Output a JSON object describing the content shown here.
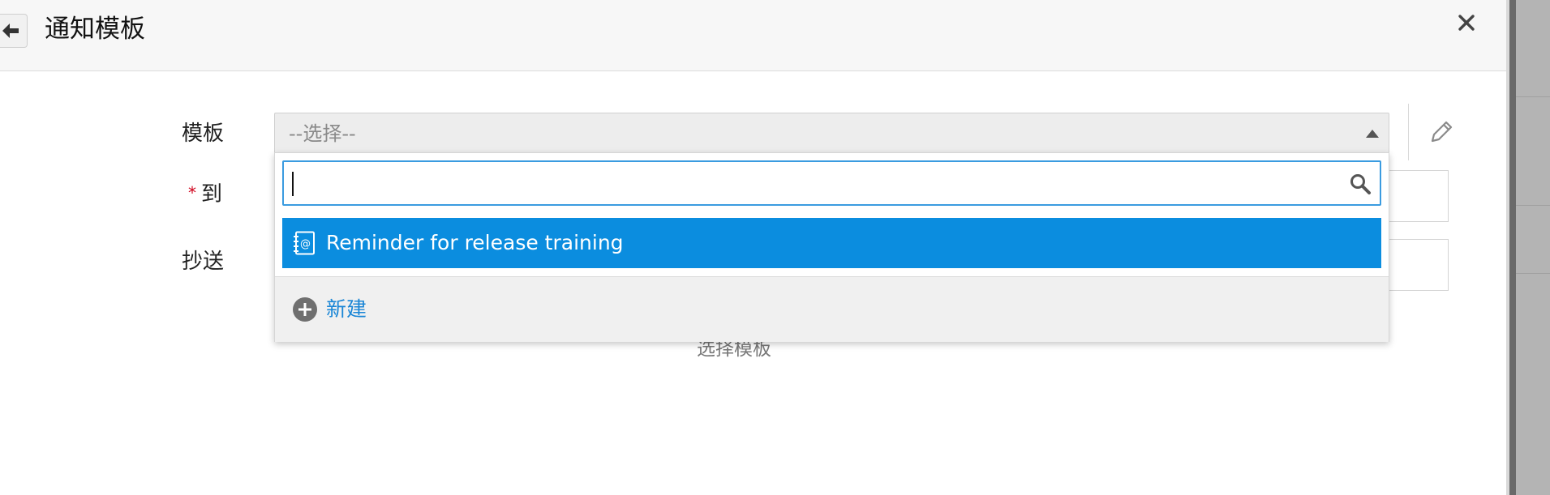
{
  "modal": {
    "title": "通知模板",
    "back_icon": "arrow-left-icon",
    "close_icon": "close-icon",
    "close_glyph": "×"
  },
  "form": {
    "template_label": "模板",
    "to_label": "到",
    "to_required_mark": "*",
    "cc_label": "抄送",
    "select_placeholder": "--选择--",
    "hint": "选择模板"
  },
  "dropdown": {
    "search_value": "",
    "options": [
      {
        "label": "Reminder for release training",
        "icon": "email-template-icon",
        "selected": true
      }
    ],
    "new_label": "新建",
    "new_icon": "plus-circle-icon"
  },
  "colors": {
    "accent": "#0b8ddf",
    "link": "#1a86d6",
    "required": "#d0021b",
    "search_border": "#3a9be0"
  }
}
